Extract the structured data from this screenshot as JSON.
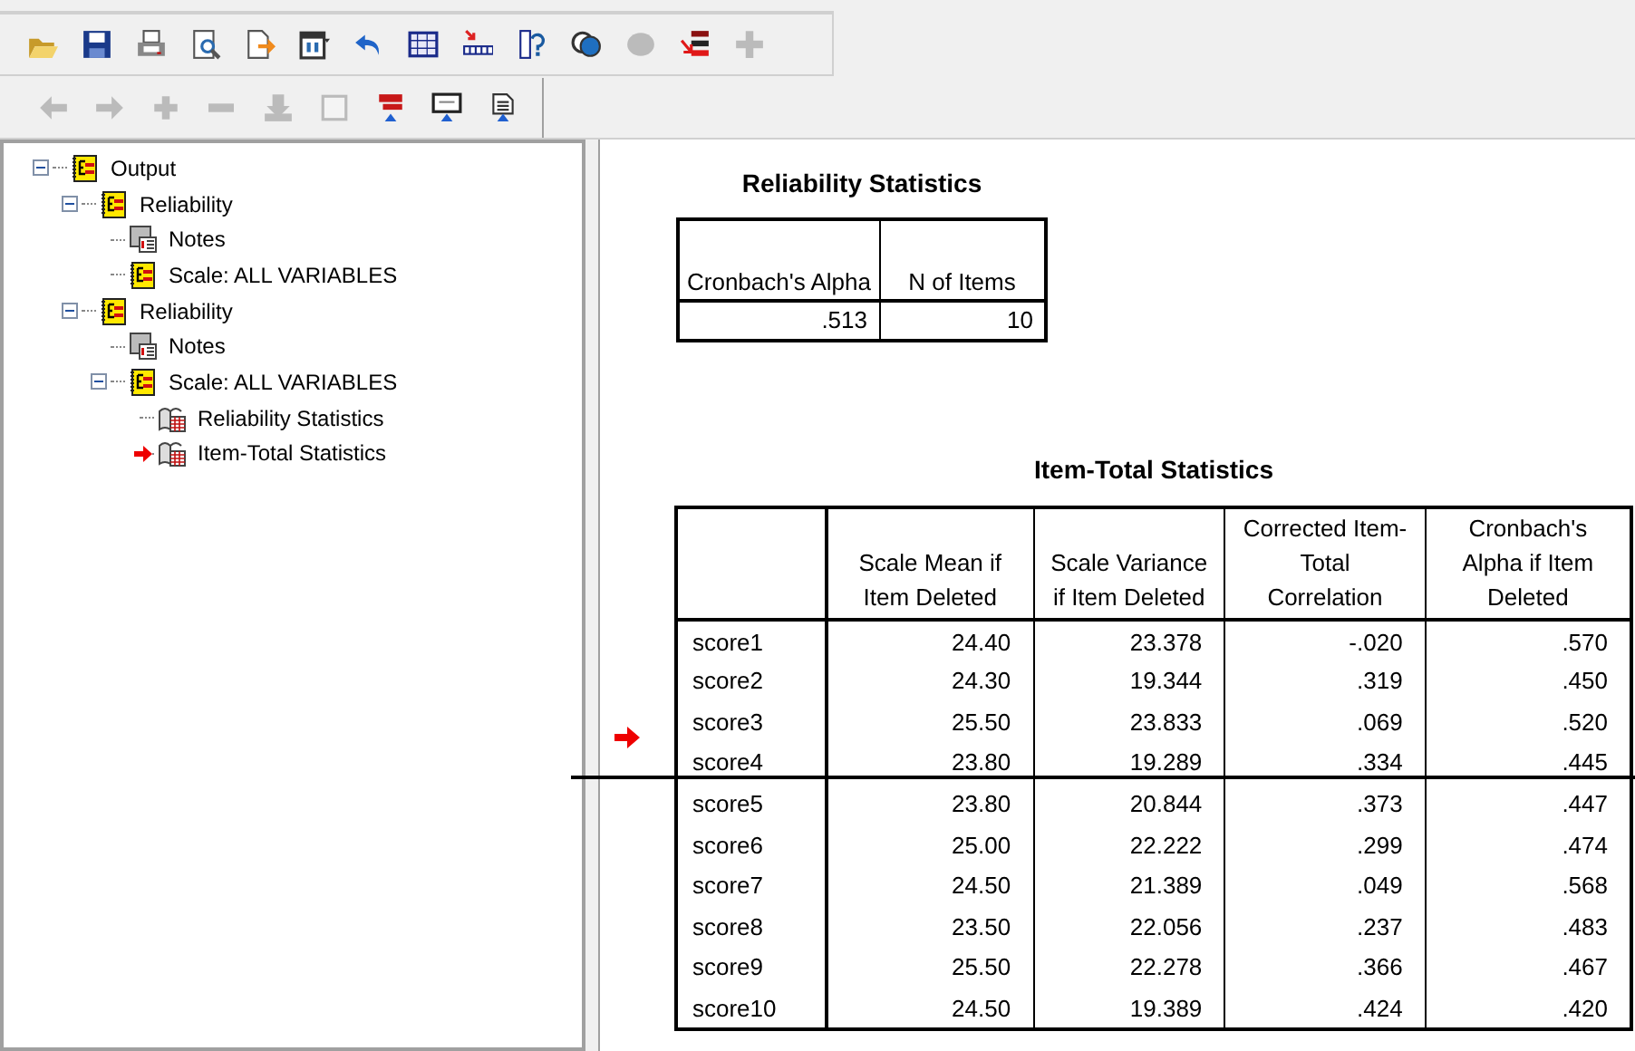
{
  "toolbar_1": [
    {
      "disabled": false
    },
    {
      "disabled": false
    },
    {
      "disabled": false
    },
    {
      "disabled": false
    },
    {
      "disabled": false
    },
    {
      "disabled": false
    },
    {
      "disabled": false
    },
    {
      "disabled": false
    },
    {
      "disabled": false
    },
    {
      "disabled": false
    },
    {
      "disabled": false
    },
    {
      "disabled": true
    },
    {
      "disabled": false
    },
    {
      "disabled": true
    }
  ],
  "toolbar_2": [
    {
      "disabled": true
    },
    {
      "disabled": true
    },
    {
      "disabled": true
    },
    {
      "disabled": true
    },
    {
      "disabled": true
    },
    {
      "disabled": true
    },
    {
      "disabled": false
    },
    {
      "disabled": false
    },
    {
      "disabled": false
    }
  ],
  "outline": [
    {
      "label": "Output",
      "kind": "book",
      "expanded": true,
      "current": false,
      "children": [
        {
          "label": "Reliability",
          "kind": "book",
          "expanded": true,
          "current": false,
          "children": [
            {
              "label": "Notes",
              "kind": "notes",
              "current": false
            },
            {
              "label": "Scale: ALL VARIABLES",
              "kind": "book",
              "current": false
            }
          ]
        },
        {
          "label": "Reliability",
          "kind": "book",
          "expanded": true,
          "current": false,
          "children": [
            {
              "label": "Notes",
              "kind": "notes",
              "current": false
            },
            {
              "label": "Scale: ALL VARIABLES",
              "kind": "book",
              "expanded": true,
              "current": false,
              "children": [
                {
                  "label": "Reliability Statistics",
                  "kind": "table",
                  "current": false
                },
                {
                  "label": "Item-Total Statistics",
                  "kind": "table",
                  "current": true
                }
              ]
            }
          ]
        }
      ]
    }
  ],
  "reliability_statistics": {
    "title": "Reliability Statistics",
    "columns": [
      "Cronbach's Alpha",
      "N of Items"
    ],
    "rows": [
      [
        ".513",
        "10"
      ]
    ]
  },
  "item_total_statistics": {
    "title": "Item-Total Statistics",
    "current": true,
    "columns": [
      "",
      "Scale Mean if Item Deleted",
      "Scale Variance if Item Deleted",
      "Corrected Item-Total Correlation",
      "Cronbach's Alpha if Item Deleted"
    ],
    "rows": [
      [
        "score1",
        "24.40",
        "23.378",
        "-.020",
        ".570"
      ],
      [
        "score2",
        "24.30",
        "19.344",
        ".319",
        ".450"
      ],
      [
        "score3",
        "25.50",
        "23.833",
        ".069",
        ".520"
      ],
      [
        "score4",
        "23.80",
        "19.289",
        ".334",
        ".445"
      ],
      [
        "score5",
        "23.80",
        "20.844",
        ".373",
        ".447"
      ],
      [
        "score6",
        "25.00",
        "22.222",
        ".299",
        ".474"
      ],
      [
        "score7",
        "24.50",
        "21.389",
        ".049",
        ".568"
      ],
      [
        "score8",
        "23.50",
        "22.056",
        ".237",
        ".483"
      ],
      [
        "score9",
        "25.50",
        "22.278",
        ".366",
        ".467"
      ],
      [
        "score10",
        "24.50",
        "19.389",
        ".424",
        ".420"
      ]
    ]
  }
}
